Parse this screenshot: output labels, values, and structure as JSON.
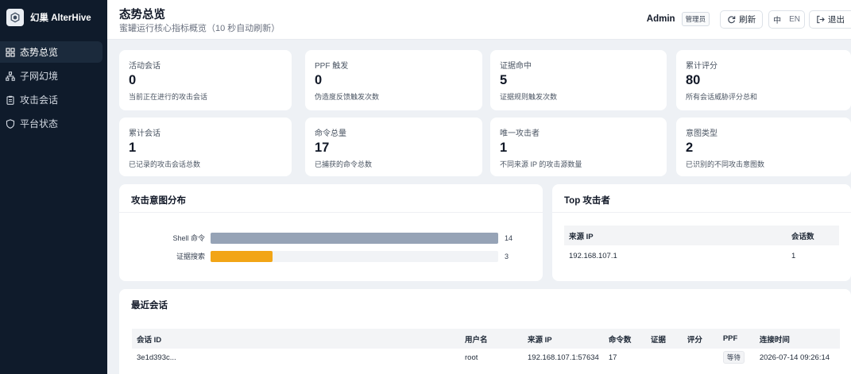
{
  "brand": {
    "name": "幻巢 AlterHive"
  },
  "sidebar": {
    "items": [
      {
        "label": "态势总览",
        "icon": "grid-icon",
        "active": true
      },
      {
        "label": "子网幻境",
        "icon": "network-icon",
        "active": false
      },
      {
        "label": "攻击会话",
        "icon": "clipboard-icon",
        "active": false
      },
      {
        "label": "平台状态",
        "icon": "shield-icon",
        "active": false
      }
    ]
  },
  "header": {
    "title": "态势总览",
    "subtitle": "蜜罐运行核心指标概览（10 秒自动刷新）",
    "user": "Admin",
    "role": "管理员",
    "refresh_label": "刷新",
    "lang_zh": "中",
    "lang_en": "EN",
    "logout_label": "退出"
  },
  "stats": [
    {
      "label": "活动会话",
      "value": "0",
      "desc": "当前正在进行的攻击会话"
    },
    {
      "label": "PPF 触发",
      "value": "0",
      "desc": "伪造度反馈触发次数"
    },
    {
      "label": "证据命中",
      "value": "5",
      "desc": "证据规则触发次数"
    },
    {
      "label": "累计评分",
      "value": "80",
      "desc": "所有会话威胁评分总和"
    },
    {
      "label": "累计会话",
      "value": "1",
      "desc": "已记录的攻击会话总数"
    },
    {
      "label": "命令总量",
      "value": "17",
      "desc": "已捕获的命令总数"
    },
    {
      "label": "唯一攻击者",
      "value": "1",
      "desc": "不同来源 IP 的攻击源数量"
    },
    {
      "label": "意图类型",
      "value": "2",
      "desc": "已识别的不同攻击意图数"
    }
  ],
  "intent_panel": {
    "title": "攻击意图分布"
  },
  "chart_data": {
    "type": "bar",
    "orientation": "horizontal",
    "categories": [
      "Shell 命令",
      "证据搜索"
    ],
    "values": [
      14,
      3
    ],
    "colors": [
      "#96a3b6",
      "#f2a516"
    ],
    "title": "攻击意图分布"
  },
  "top_attackers": {
    "title": "Top 攻击者",
    "columns": [
      "来源 IP",
      "会话数"
    ],
    "rows": [
      [
        "192.168.107.1",
        "1"
      ]
    ]
  },
  "recent_sessions": {
    "title": "最近会话",
    "columns": [
      "会话 ID",
      "用户名",
      "来源 IP",
      "命令数",
      "证据",
      "评分",
      "PPF",
      "连接时间"
    ],
    "rows": [
      {
        "id": "3e1d393c...",
        "user": "root",
        "ip": "192.168.107.1:57634",
        "commands": "17",
        "evidence": "",
        "score": "",
        "ppf": "等待",
        "time": "2026-07-14 09:26:14"
      }
    ]
  }
}
